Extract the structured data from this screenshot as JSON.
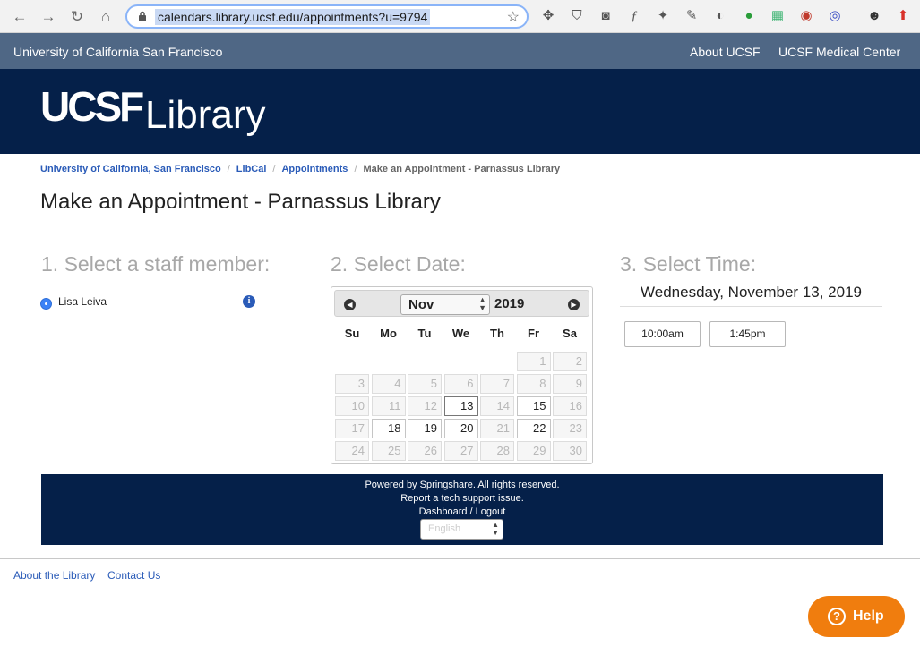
{
  "browser": {
    "url": "calendars.library.ucsf.edu/appointments?u=9794",
    "icons": [
      "back-icon",
      "forward-icon",
      "reload-icon",
      "home-icon",
      "lock-icon",
      "star-icon"
    ]
  },
  "top_bar": {
    "university": "University of California San Francisco",
    "links": [
      "About UCSF",
      "UCSF Medical Center"
    ]
  },
  "logo": {
    "ucsf": "UCSF",
    "library": "Library"
  },
  "breadcrumb": {
    "items": [
      "University of California, San Francisco",
      "LibCal",
      "Appointments"
    ],
    "separator": "/",
    "current": "Make an Appointment - Parnassus Library"
  },
  "page_title": "Make an Appointment - Parnassus Library",
  "steps": {
    "staff": "1. Select a staff member:",
    "date": "2. Select Date:",
    "time": "3. Select Time:"
  },
  "staff": {
    "name": "Lisa Leiva",
    "info": "i"
  },
  "calendar": {
    "prev": "◀",
    "next": "▶",
    "month": "Nov",
    "year": "2019",
    "weekdays": [
      "Su",
      "Mo",
      "Tu",
      "We",
      "Th",
      "Fr",
      "Sa"
    ],
    "weeks": [
      [
        "",
        "",
        "",
        "",
        "",
        "1",
        "2"
      ],
      [
        "3",
        "4",
        "5",
        "6",
        "7",
        "8",
        "9"
      ],
      [
        "10",
        "11",
        "12",
        "13",
        "14",
        "15",
        "16"
      ],
      [
        "17",
        "18",
        "19",
        "20",
        "21",
        "22",
        "23"
      ],
      [
        "24",
        "25",
        "26",
        "27",
        "28",
        "29",
        "30"
      ]
    ],
    "available": [
      "13",
      "15",
      "18",
      "19",
      "20",
      "22"
    ],
    "selected": "13"
  },
  "time": {
    "date_heading": "Wednesday, November 13, 2019",
    "slots": [
      "10:00am",
      "1:45pm"
    ]
  },
  "footer": {
    "powered": "Powered by Springshare. All rights reserved.",
    "report": "Report a tech support issue.",
    "dashboard": "Dashboard",
    "slash": "/",
    "logout": "Logout",
    "language": "English"
  },
  "bottom_links": [
    "About the Library",
    "Contact Us"
  ],
  "help": {
    "icon": "?",
    "label": "Help"
  },
  "colors": {
    "top_bar": "#4f6785",
    "navy": "#052049",
    "link": "#2a5bb8",
    "help": "#f07d0e"
  }
}
